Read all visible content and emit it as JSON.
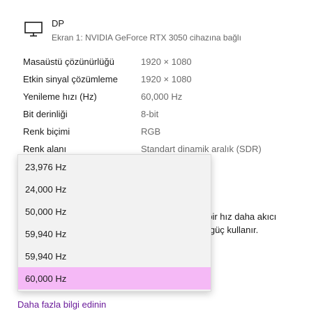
{
  "display": {
    "name": "DP",
    "subtitle": "Ekran 1: NVIDIA GeForce RTX 3050 cihazına bağlı",
    "icon": "monitor-icon"
  },
  "properties": [
    {
      "label": "Masaüstü çözünürlüğü",
      "value": "1920 × 1080"
    },
    {
      "label": "Etkin sinyal çözümleme",
      "value": "1920 × 1080"
    },
    {
      "label": "Yenileme hızı (Hz)",
      "value": "60,000 Hz"
    },
    {
      "label": "Bit derinliği",
      "value": "8-bit"
    },
    {
      "label": "Renk biçimi",
      "value": "RGB"
    },
    {
      "label": "Renk alanı",
      "value": "Standart dinamik aralık (SDR)"
    }
  ],
  "background_text": {
    "line1": "t bir hız daha akıcı",
    "line2": "a güç kullanır."
  },
  "refresh_dropdown": {
    "options": [
      "23,976 Hz",
      "24,000 Hz",
      "50,000 Hz",
      "59,940 Hz",
      "59,940 Hz",
      "60,000 Hz"
    ],
    "selected": "60,000 Hz"
  },
  "links": {
    "learn_more": "Daha fazla bilgi edinin"
  },
  "colors": {
    "selected_bg": "#f5b9f6",
    "link": "#6a1b9a"
  }
}
